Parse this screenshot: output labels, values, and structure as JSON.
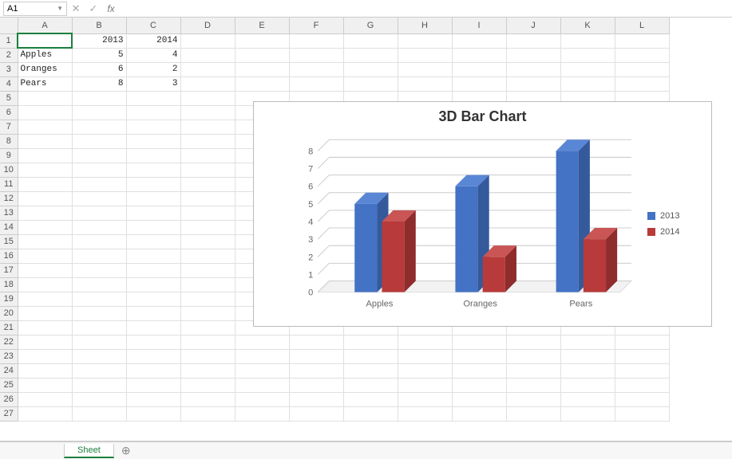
{
  "name_box": "A1",
  "formula_value": "",
  "columns": [
    "A",
    "B",
    "C",
    "D",
    "E",
    "F",
    "G",
    "H",
    "I",
    "J",
    "K",
    "L"
  ],
  "row_count": 27,
  "cells": {
    "B1": {
      "v": "2013",
      "t": "num"
    },
    "C1": {
      "v": "2014",
      "t": "num"
    },
    "A2": {
      "v": "Apples",
      "t": "txt"
    },
    "B2": {
      "v": "5",
      "t": "num"
    },
    "C2": {
      "v": "4",
      "t": "num"
    },
    "A3": {
      "v": "Oranges",
      "t": "txt"
    },
    "B3": {
      "v": "6",
      "t": "num"
    },
    "C3": {
      "v": "2",
      "t": "num"
    },
    "A4": {
      "v": "Pears",
      "t": "txt"
    },
    "B4": {
      "v": "8",
      "t": "num"
    },
    "C4": {
      "v": "3",
      "t": "num"
    }
  },
  "selected_cell": "A1",
  "sheet_tab": "Sheet",
  "chart_data": {
    "type": "bar",
    "title": "3D Bar Chart",
    "categories": [
      "Apples",
      "Oranges",
      "Pears"
    ],
    "series": [
      {
        "name": "2013",
        "values": [
          5,
          6,
          8
        ],
        "color": "#4472c4"
      },
      {
        "name": "2014",
        "values": [
          4,
          2,
          3
        ],
        "color": "#b83a3a"
      }
    ],
    "xlabel": "",
    "ylabel": "",
    "ylim": [
      0,
      8
    ],
    "yticks": [
      0,
      1,
      2,
      3,
      4,
      5,
      6,
      7,
      8
    ],
    "legend_position": "right",
    "grid": true
  }
}
